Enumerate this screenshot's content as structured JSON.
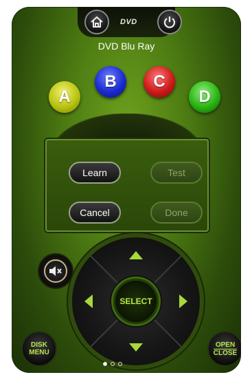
{
  "header": {
    "logo_text": "DVD",
    "device_name": "DVD Blu Ray"
  },
  "color_buttons": [
    {
      "label": "A",
      "color": "#c8d21a"
    },
    {
      "label": "B",
      "color": "#1a2bd0"
    },
    {
      "label": "C",
      "color": "#d01a1a"
    },
    {
      "label": "D",
      "color": "#2bb414"
    }
  ],
  "dialog": {
    "learn_label": "Learn",
    "test_label": "Test",
    "cancel_label": "Cancel",
    "done_label": "Done"
  },
  "dpad": {
    "select_label": "SELECT"
  },
  "corner": {
    "disk_menu_line1": "DISK",
    "disk_menu_line2": "MENU",
    "open_close_line1": "OPEN",
    "open_close_line2": "CLOSE"
  },
  "page_indicator": {
    "count": 3,
    "current": 1
  },
  "colors": {
    "accent": "#b7e84a",
    "bg": "#4c7a12"
  }
}
